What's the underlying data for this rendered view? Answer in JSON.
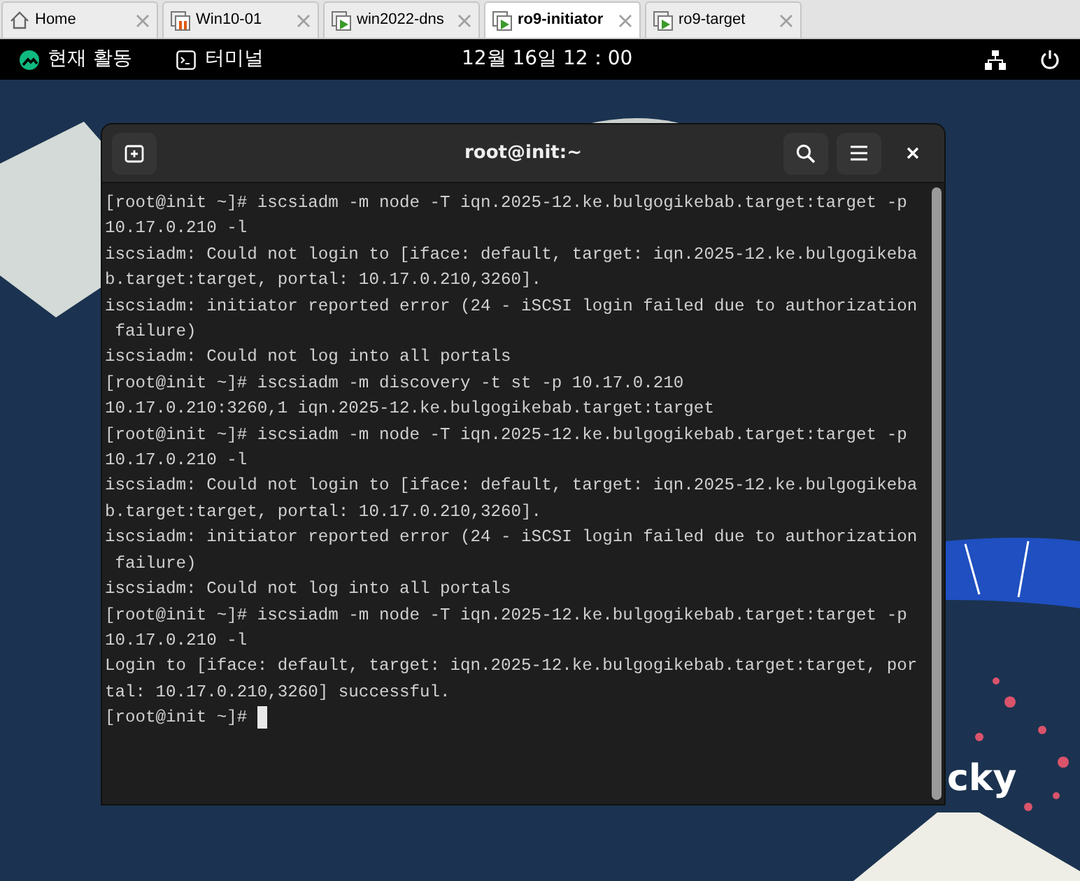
{
  "host_tabs": [
    {
      "label": "Home",
      "kind": "home",
      "selected": false
    },
    {
      "label": "Win10-01",
      "kind": "paused",
      "selected": false
    },
    {
      "label": "win2022-dns",
      "kind": "running",
      "selected": false
    },
    {
      "label": "ro9-initiator",
      "kind": "running",
      "selected": true
    },
    {
      "label": "ro9-target",
      "kind": "running",
      "selected": false
    }
  ],
  "top_bar": {
    "activities": "현재 활동",
    "app": "터미널",
    "clock": "12월 16일 12：00"
  },
  "wallpaper_text": "cky",
  "terminal": {
    "title": "root@init:~",
    "lines": [
      "[root@init ~]# iscsiadm -m node -T iqn.2025-12.ke.bulgogikebab.target:target -p",
      "10.17.0.210 -l",
      "iscsiadm: Could not login to [iface: default, target: iqn.2025-12.ke.bulgogikeba",
      "b.target:target, portal: 10.17.0.210,3260].",
      "iscsiadm: initiator reported error (24 - iSCSI login failed due to authorization",
      " failure)",
      "iscsiadm: Could not log into all portals",
      "[root@init ~]# iscsiadm -m discovery -t st -p 10.17.0.210",
      "10.17.0.210:3260,1 iqn.2025-12.ke.bulgogikebab.target:target",
      "[root@init ~]# iscsiadm -m node -T iqn.2025-12.ke.bulgogikebab.target:target -p",
      "10.17.0.210 -l",
      "iscsiadm: Could not login to [iface: default, target: iqn.2025-12.ke.bulgogikeba",
      "b.target:target, portal: 10.17.0.210,3260].",
      "iscsiadm: initiator reported error (24 - iSCSI login failed due to authorization",
      " failure)",
      "iscsiadm: Could not log into all portals",
      "[root@init ~]# iscsiadm -m node -T iqn.2025-12.ke.bulgogikebab.target:target -p",
      "10.17.0.210 -l",
      "Login to [iface: default, target: iqn.2025-12.ke.bulgogikebab.target:target, por",
      "tal: 10.17.0.210,3260] successful.",
      "[root@init ~]# "
    ]
  }
}
